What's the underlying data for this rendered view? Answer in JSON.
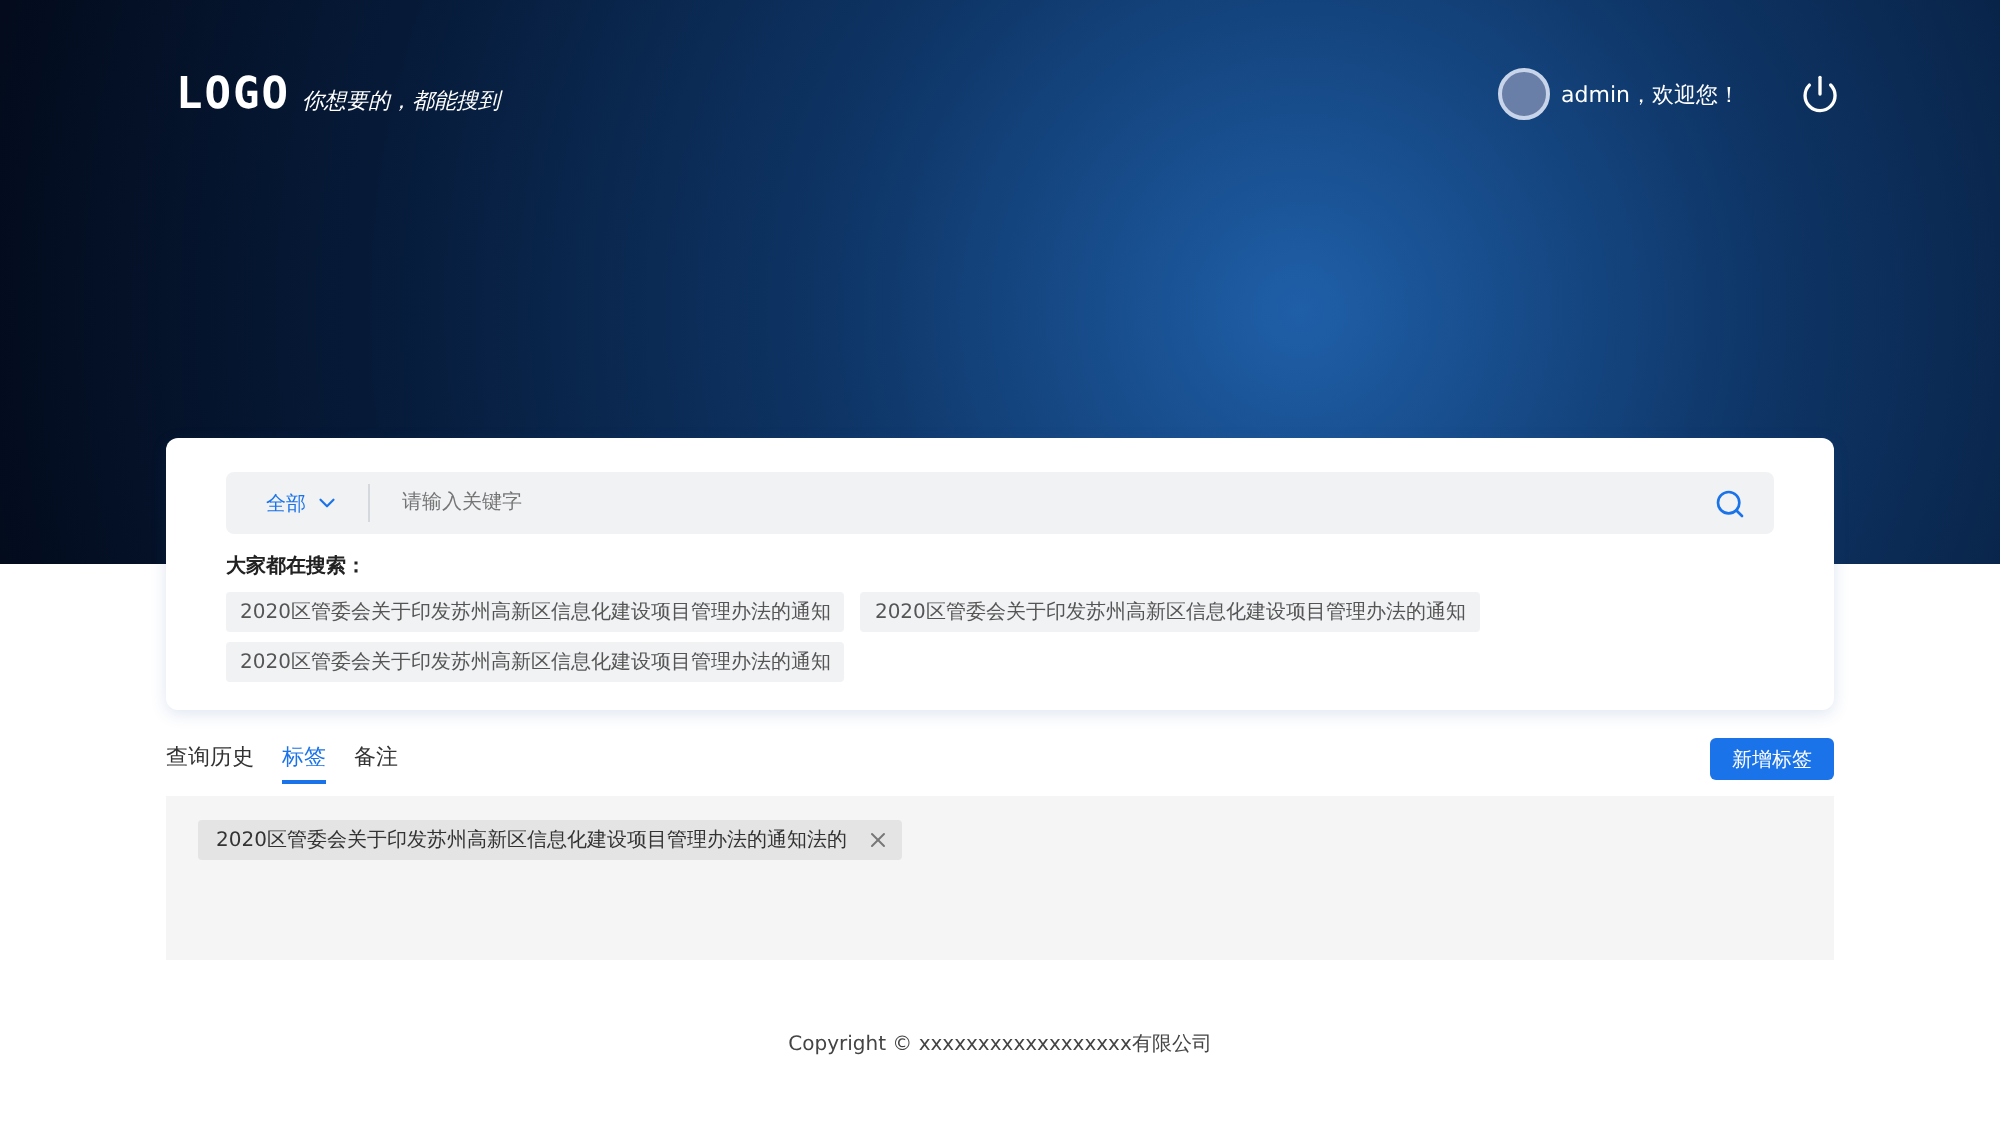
{
  "header": {
    "logo": "LOGO",
    "slogan": "你想要的，都能搜到",
    "user_greeting": "admin，欢迎您！"
  },
  "search": {
    "scope": "全部",
    "placeholder": "请输入关键字",
    "hot_label": "大家都在搜索：",
    "hot_items": [
      "2020区管委会关于印发苏州高新区信息化建设项目管理办法的通知",
      "2020区管委会关于印发苏州高新区信息化建设项目管理办法的通知",
      "2020区管委会关于印发苏州高新区信息化建设项目管理办法的通知"
    ]
  },
  "tabs": [
    {
      "label": "查询历史",
      "selected": false
    },
    {
      "label": "标签",
      "selected": true
    },
    {
      "label": "备注",
      "selected": false
    }
  ],
  "add_button": "新增标签",
  "tags": [
    {
      "label": "2020区管委会关于印发苏州高新区信息化建设项目管理办法的通知法的"
    }
  ],
  "footer": "Copyright © xxxxxxxxxxxxxxxxxx有限公司"
}
